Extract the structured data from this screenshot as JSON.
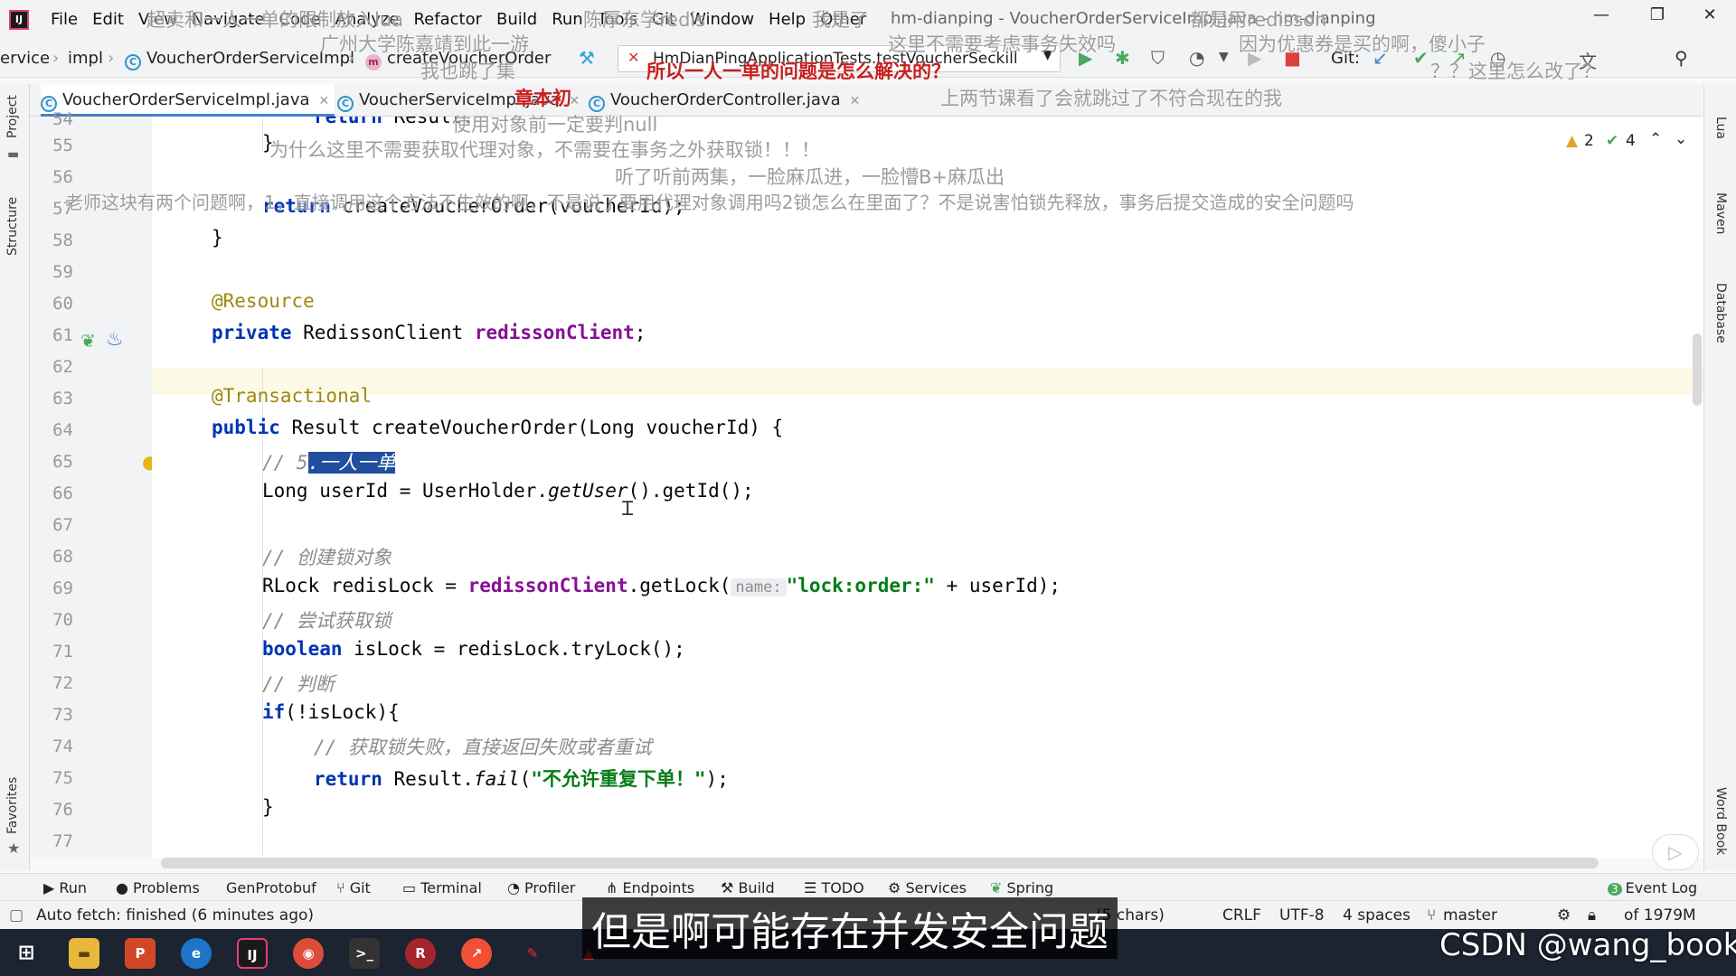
{
  "menubar": {
    "items": [
      "File",
      "Edit",
      "View",
      "Navigate",
      "Code",
      "Analyze",
      "Refactor",
      "Build",
      "Run",
      "Tools",
      "Git",
      "Window",
      "Help",
      "Other"
    ],
    "window_title": "hm-dianping - VoucherOrderServiceImpl.java - hm-dianping"
  },
  "navbar": {
    "crumbs": [
      "ervice",
      "impl",
      "VoucherOrderServiceImpl",
      "createVoucherOrder"
    ],
    "run_config": "HmDianPingApplicationTests.testVoucherSeckill",
    "git_label": "Git:"
  },
  "tabs": [
    {
      "label": "VoucherOrderServiceImpl.java",
      "active": true
    },
    {
      "label": "VoucherServiceImpl.java",
      "active": false
    },
    {
      "label": "VoucherOrderController.java",
      "active": false
    }
  ],
  "inspections": {
    "warnings": "2",
    "ok": "4"
  },
  "left_tools": [
    "Project",
    "Structure",
    "Favorites"
  ],
  "right_tools": [
    "Lua",
    "Maven",
    "Database",
    "Word Book"
  ],
  "editor": {
    "line_numbers": [
      "54",
      "55",
      "56",
      "57",
      "58",
      "59",
      "60",
      "61",
      "62",
      "63",
      "64",
      "65",
      "66",
      "67",
      "68",
      "69",
      "70",
      "71",
      "72",
      "73",
      "74",
      "75",
      "76",
      "77"
    ],
    "line54": {
      "kw": "return",
      "rest": " Result."
    },
    "line55": "}",
    "line57": {
      "kw": "return",
      "rest": " createVoucherOrder(voucherId);"
    },
    "line58": "}",
    "line60": "@Resource",
    "line61": {
      "kw": "private",
      "type": " RedissonClient ",
      "field": "redissonClient",
      "end": ";"
    },
    "line63": "@Transactional",
    "line64": {
      "kw": "public",
      "rest": " Result createVoucherOrder(Long voucherId) {"
    },
    "line65": {
      "prefix": "// 5",
      "selected": ".一人一单"
    },
    "line66": {
      "a": "Long userId = UserHolder.",
      "it": "getUser",
      "b": "().getId();"
    },
    "line68": "// 创建锁对象",
    "line69": {
      "a": "RLock redisLock = ",
      "field": "redissonClient",
      "b": ".getLock(",
      "hint": "name:",
      "str": "\"lock:order:\"",
      "c": " + userId);"
    },
    "line70": "// 尝试获取锁",
    "line71": {
      "kw": "boolean",
      "rest": " isLock = redisLock.tryLock();"
    },
    "line72": "// 判断",
    "line73": {
      "kw": "if",
      "rest": "(!isLock){"
    },
    "line74": "// 获取锁失败，直接返回失败或者重试",
    "line75": {
      "kw": "return",
      "a": " Result.",
      "it": "fail",
      "b": "(",
      "str": "\"不允许重复下单！\"",
      "c": ");"
    },
    "line76": "}"
  },
  "tool_tabs": [
    "Run",
    "Problems",
    "GenProtobuf",
    "Git",
    "Terminal",
    "Profiler",
    "Endpoints",
    "Build",
    "TODO",
    "Services",
    "Spring",
    "Event Log"
  ],
  "status": {
    "left": "Auto fetch: finished (6 minutes ago)",
    "chars": "(5 chars)",
    "line_sep": "CRLF",
    "encoding": "UTF-8",
    "indent": "4 spaces",
    "branch": "master",
    "memory": "of 1979M"
  },
  "danmaku": [
    "超卖和一人一单的限制放入lua",
    "陈厚东学redis",
    "我是了",
    "都是用redisson",
    "广州大学陈嘉靖到此一游",
    "这里不需要考虑事务失效吗",
    "因为优惠券是买的啊，傻小子",
    "我也跳了集",
    "所以一人一单的问题是怎么解决的？",
    "？？这里怎么改了？",
    "章本初",
    "上两节课看了会就跳过了不符合现在的我",
    "使用对象前一定要判null",
    "为什么这里不需要获取代理对象，不需要在事务之外获取锁！！！",
    "听了听前两集，一脸麻瓜进，一脸懵B+麻瓜出",
    "老师这块有两个问题啊，1，直接调用这个方法不生效的啊，不是说了要用代理对象调用吗2锁怎么在里面了？不是说害怕锁先释放，事务后提交造成的安全问题吗"
  ],
  "subtitle": "但是啊可能存在并发安全问题",
  "watermark": "CSDN @wang_book"
}
